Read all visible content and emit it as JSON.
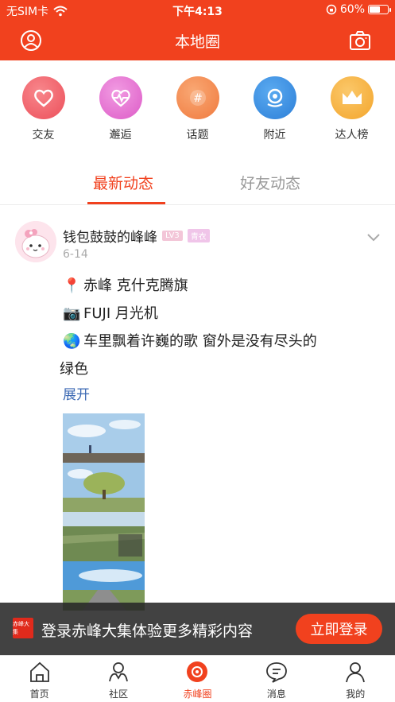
{
  "status": {
    "carrier": "无SIM卡",
    "time": "下午4:13",
    "battery": "60%",
    "battery_level": 0.6
  },
  "header": {
    "title": "本地圈",
    "left_icon": "profile-icon",
    "right_icon": "camera-icon"
  },
  "categories": [
    {
      "label": "交友",
      "icon": "heart-icon",
      "color": "#f0636b"
    },
    {
      "label": "邂逅",
      "icon": "heartbeat-icon",
      "color": "#e86bd3"
    },
    {
      "label": "话题",
      "icon": "hashtag-icon",
      "color": "#f58a52"
    },
    {
      "label": "附近",
      "icon": "location-icon",
      "color": "#3b92e8"
    },
    {
      "label": "达人榜",
      "icon": "crown-icon",
      "color": "#f7b441"
    }
  ],
  "tabs": [
    {
      "label": "最新动态",
      "active": true
    },
    {
      "label": "好友动态",
      "active": false
    }
  ],
  "post": {
    "author": "钱包鼓鼓的峰峰",
    "level": "LV3",
    "title_badge": "青衣",
    "date": "6-14",
    "lines": [
      {
        "icon": "📍",
        "text": "赤峰 克什克腾旗"
      },
      {
        "icon": "📷",
        "text": "FUJI 月光机"
      },
      {
        "icon": "🌏",
        "text": "车里飘着许巍的歌 窗外是没有尽头的"
      },
      {
        "icon": "",
        "text": "绿色"
      }
    ],
    "more": "展开"
  },
  "login_banner": {
    "logo_text": "赤峰大集",
    "text": "登录赤峰大集体验更多精彩内容",
    "button": "立即登录"
  },
  "tabbar": [
    {
      "label": "首页",
      "icon": "home-icon",
      "active": false
    },
    {
      "label": "社区",
      "icon": "community-icon",
      "active": false
    },
    {
      "label": "赤峰圈",
      "icon": "circle-camera-icon",
      "active": true
    },
    {
      "label": "消息",
      "icon": "message-icon",
      "active": false
    },
    {
      "label": "我的",
      "icon": "user-icon",
      "active": false
    }
  ],
  "colors": {
    "brand": "#f1411e",
    "link": "#3d6ab4"
  }
}
